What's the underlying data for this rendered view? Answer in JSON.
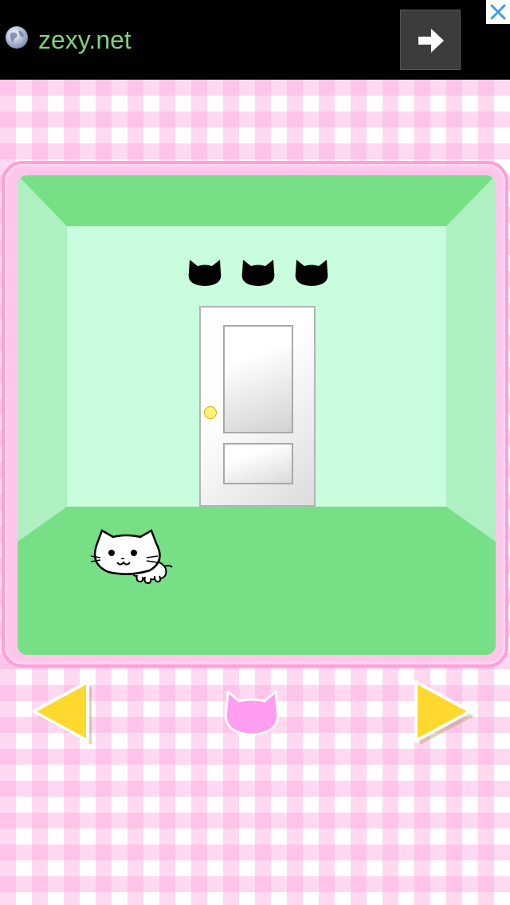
{
  "ad": {
    "domain": "zexy.net",
    "icons": [
      "globe-icon",
      "arrow-right-icon",
      "close-icon"
    ]
  },
  "room": {
    "wall_cat_count": 3,
    "objects": [
      "door",
      "door-knob",
      "white-cat"
    ]
  },
  "navigation": {
    "left": "triangle-left-icon",
    "center": "cat-head-icon",
    "right": "triangle-right-icon"
  },
  "colors": {
    "ceiling_floor_green": "#77e086",
    "back_wall_mint": "#c8fedd",
    "side_wall_green": "#aef0c2",
    "frame_pink": "#ff9fd8",
    "arrow_yellow": "#ffd92e",
    "center_cat_pink": "#ff9df0"
  }
}
